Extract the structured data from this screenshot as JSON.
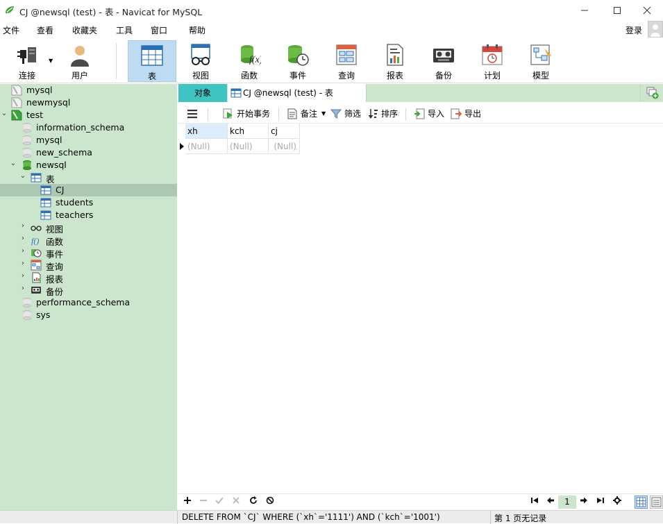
{
  "window": {
    "title": "CJ @newsql (test) - 表 - Navicat for MySQL",
    "controls": [
      "minimize",
      "maximize",
      "close"
    ]
  },
  "menu": {
    "items": [
      "文件",
      "查看",
      "收藏夹",
      "工具",
      "窗口",
      "帮助"
    ],
    "login_label": "登录"
  },
  "toolbar": {
    "buttons": [
      {
        "label": "连接",
        "icon": "plug-icon"
      },
      {
        "label": "用户",
        "icon": "user-icon"
      },
      {
        "label": "表",
        "icon": "table-icon",
        "active": true
      },
      {
        "label": "视图",
        "icon": "view-glasses-icon"
      },
      {
        "label": "函数",
        "icon": "function-icon"
      },
      {
        "label": "事件",
        "icon": "event-clock-icon"
      },
      {
        "label": "查询",
        "icon": "query-icon"
      },
      {
        "label": "报表",
        "icon": "report-icon"
      },
      {
        "label": "备份",
        "icon": "backup-tape-icon"
      },
      {
        "label": "计划",
        "icon": "calendar-icon"
      },
      {
        "label": "模型",
        "icon": "model-icon"
      }
    ]
  },
  "sidebar": {
    "tree": [
      {
        "label": "mysql",
        "level": 0,
        "type": "connection"
      },
      {
        "label": "newmysql",
        "level": 0,
        "type": "connection"
      },
      {
        "label": "test",
        "level": 0,
        "type": "connection-open",
        "expanded": true
      },
      {
        "label": "information_schema",
        "level": 1,
        "type": "database"
      },
      {
        "label": "mysql",
        "level": 1,
        "type": "database"
      },
      {
        "label": "new_schema",
        "level": 1,
        "type": "database"
      },
      {
        "label": "newsql",
        "level": 1,
        "type": "database-open",
        "expanded": true
      },
      {
        "label": "表",
        "level": 2,
        "type": "table-folder",
        "expanded": true
      },
      {
        "label": "CJ",
        "level": 3,
        "type": "table",
        "selected": true
      },
      {
        "label": "students",
        "level": 3,
        "type": "table"
      },
      {
        "label": "teachers",
        "level": 3,
        "type": "table"
      },
      {
        "label": "视图",
        "level": 2,
        "type": "view-folder",
        "collapsed": true
      },
      {
        "label": "函数",
        "level": 2,
        "type": "function-folder",
        "collapsed": true
      },
      {
        "label": "事件",
        "level": 2,
        "type": "event-folder",
        "collapsed": true
      },
      {
        "label": "查询",
        "level": 2,
        "type": "query-folder",
        "collapsed": true
      },
      {
        "label": "报表",
        "level": 2,
        "type": "report-folder",
        "collapsed": true
      },
      {
        "label": "备份",
        "level": 2,
        "type": "backup-folder",
        "collapsed": true
      },
      {
        "label": "performance_schema",
        "level": 1,
        "type": "database"
      },
      {
        "label": "sys",
        "level": 1,
        "type": "database"
      }
    ]
  },
  "tabs": {
    "objects_label": "对象",
    "active_label": "CJ @newsql (test) - 表"
  },
  "object_toolbar": {
    "begin_transaction": "开始事务",
    "memo": "备注",
    "filter": "筛选",
    "sort": "排序",
    "import": "导入",
    "export": "导出"
  },
  "grid": {
    "columns": [
      "xh",
      "kch",
      "cj"
    ],
    "rows": [
      [
        "(Null)",
        "(Null)",
        "(Null)"
      ]
    ]
  },
  "navigation": {
    "page": "1"
  },
  "status": {
    "sql": "DELETE FROM `CJ` WHERE (`xh`='1111') AND (`kch`='1001')",
    "record_info": "第 1 页无记录"
  },
  "colors": {
    "sidebar_bg": "#cbe6cd",
    "selected_row": "#adc8b2",
    "objects_tab": "#3fc4c3",
    "active_toolbar": "#bfdbf3"
  }
}
